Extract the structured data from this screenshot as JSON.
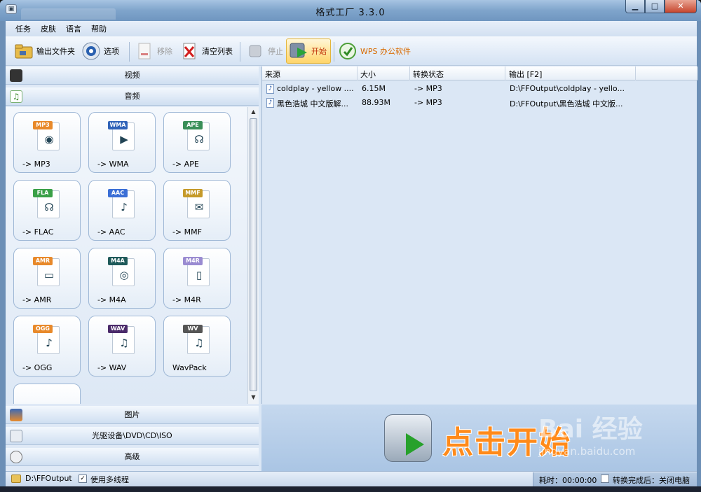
{
  "window": {
    "title": "格式工厂 3.3.0"
  },
  "menu": [
    "任务",
    "皮肤",
    "语言",
    "帮助"
  ],
  "toolbar": {
    "output_folder": "输出文件夹",
    "options": "选项",
    "remove": "移除",
    "clear_list": "清空列表",
    "stop": "停止",
    "start": "开始",
    "wps": "WPS 办公软件"
  },
  "sidebar": {
    "categories": {
      "video": "视频",
      "audio": "音频",
      "picture": "图片",
      "rom": "光驱设备\\DVD\\CD\\ISO",
      "advanced": "高级"
    },
    "formats": [
      {
        "tag": "MP3",
        "label": "-> MP3",
        "color": "#e8892a",
        "icon": "speaker-icon"
      },
      {
        "tag": "WMA",
        "label": "-> WMA",
        "color": "#2f62b8",
        "icon": "play-circle-icon"
      },
      {
        "tag": "APE",
        "label": "-> APE",
        "color": "#3a8f58",
        "icon": "headphone-icon"
      },
      {
        "tag": "FLA",
        "label": "-> FLAC",
        "color": "#3aa047",
        "icon": "headphones-icon"
      },
      {
        "tag": "AAC",
        "label": "-> AAC",
        "color": "#3b6fd6",
        "icon": "music-note-icon"
      },
      {
        "tag": "MMF",
        "label": "-> MMF",
        "color": "#c59a2a",
        "icon": "envelope-icon"
      },
      {
        "tag": "AMR",
        "label": "-> AMR",
        "color": "#e8892a",
        "icon": "laptop-icon"
      },
      {
        "tag": "M4A",
        "label": "-> M4A",
        "color": "#1f5a5a",
        "icon": "cd-icon"
      },
      {
        "tag": "M4R",
        "label": "-> M4R",
        "color": "#9a8bd1",
        "icon": "phone-icon"
      },
      {
        "tag": "OGG",
        "label": "-> OGG",
        "color": "#e8892a",
        "icon": "music-note-icon"
      },
      {
        "tag": "WAV",
        "label": "-> WAV",
        "color": "#4a2a6a",
        "icon": "music-notes-icon"
      },
      {
        "tag": "WV",
        "label": "WavPack",
        "color": "#555555",
        "icon": "music-note-green-icon"
      }
    ]
  },
  "tasks": {
    "columns": [
      "来源",
      "大小",
      "转换状态",
      "输出 [F2]"
    ],
    "rows": [
      {
        "source": "coldplay - yellow ....",
        "size": "6.15M",
        "status": "-> MP3",
        "output": "D:\\FFOutput\\coldplay - yello..."
      },
      {
        "source": "黑色浩城 中文版解...",
        "size": "88.93M",
        "status": "-> MP3",
        "output": "D:\\FFOutput\\黑色浩城 中文版..."
      }
    ]
  },
  "banner": {
    "text": "点击开始",
    "watermark": "Bai 经验",
    "watermark_sub": "jingyan.baidu.com"
  },
  "status": {
    "folder": "D:\\FFOutput",
    "multithread": "使用多线程",
    "elapsed": "耗时：00:00:00",
    "after_convert": "转换完成后：关闭电脑"
  }
}
